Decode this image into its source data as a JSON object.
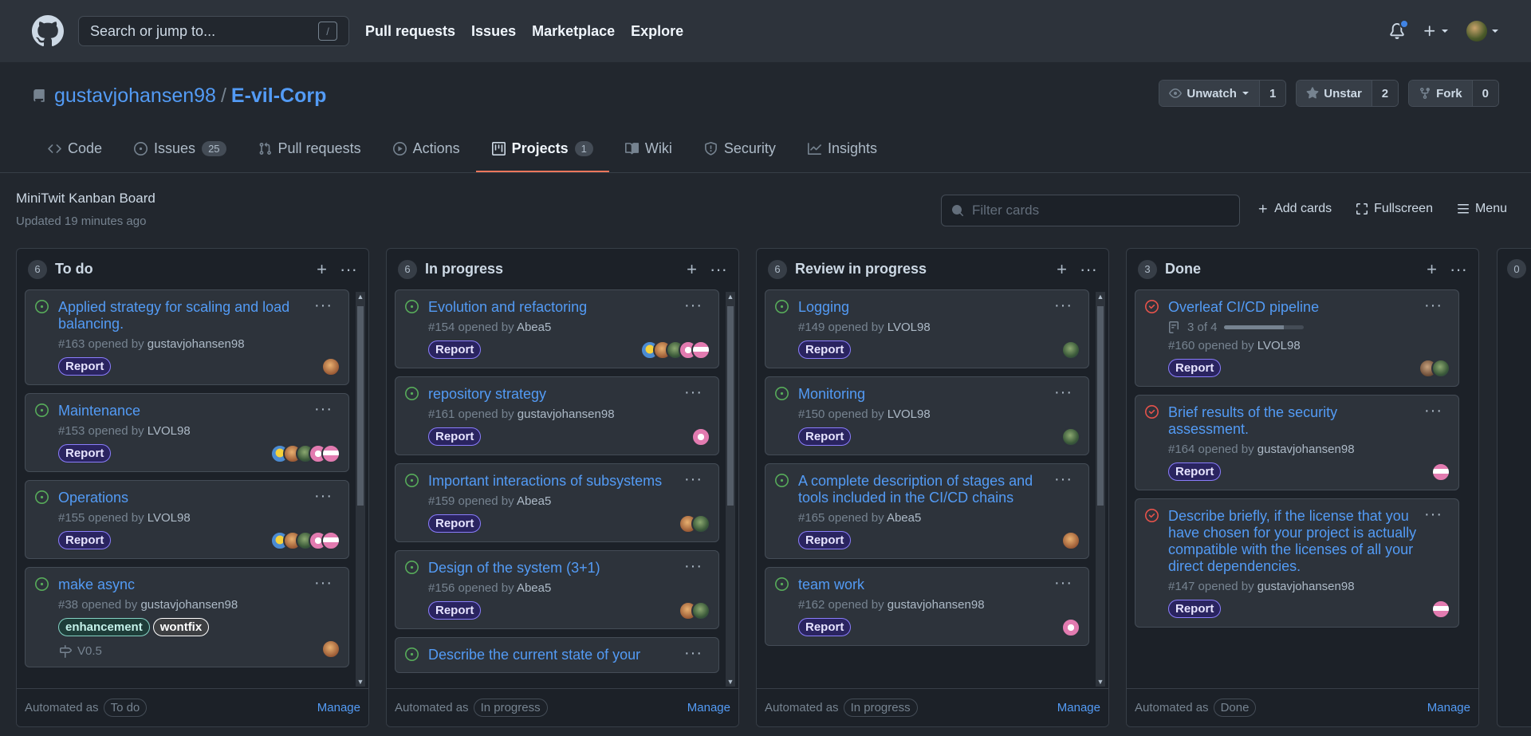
{
  "header": {
    "search_placeholder": "Search or jump to...",
    "search_key": "/",
    "nav": [
      "Pull requests",
      "Issues",
      "Marketplace",
      "Explore"
    ]
  },
  "repo": {
    "owner": "gustavjohansen98",
    "separator": "/",
    "name": "E-vil-Corp",
    "unwatch_label": "Unwatch",
    "unwatch_count": "1",
    "unstar_label": "Unstar",
    "unstar_count": "2",
    "fork_label": "Fork",
    "fork_count": "0"
  },
  "tabs": [
    {
      "label": "Code",
      "count": ""
    },
    {
      "label": "Issues",
      "count": "25"
    },
    {
      "label": "Pull requests",
      "count": ""
    },
    {
      "label": "Actions",
      "count": ""
    },
    {
      "label": "Projects",
      "count": "1"
    },
    {
      "label": "Wiki",
      "count": ""
    },
    {
      "label": "Security",
      "count": ""
    },
    {
      "label": "Insights",
      "count": ""
    }
  ],
  "project": {
    "name": "MiniTwit Kanban Board",
    "updated": "Updated 19 minutes ago",
    "filter_placeholder": "Filter cards",
    "add_cards": "Add cards",
    "fullscreen": "Fullscreen",
    "menu": "Menu"
  },
  "columns": [
    {
      "count": "6",
      "title": "To do",
      "automated_prefix": "Automated as",
      "automated": "To do",
      "manage": "Manage",
      "cards": [
        {
          "title": "Applied strategy for scaling and load balancing.",
          "number": "#163 opened by",
          "author": "gustavjohansen98",
          "labels": [
            "Report"
          ]
        },
        {
          "title": "Maintenance",
          "number": "#153 opened by",
          "author": "LVOL98",
          "labels": [
            "Report"
          ]
        },
        {
          "title": "Operations",
          "number": "#155 opened by",
          "author": "LVOL98",
          "labels": [
            "Report"
          ]
        },
        {
          "title": "make async",
          "number": "#38 opened by",
          "author": "gustavjohansen98",
          "labels": [
            "enhancement",
            "wontfix"
          ],
          "milestone": "V0.5"
        }
      ]
    },
    {
      "count": "6",
      "title": "In progress",
      "automated_prefix": "Automated as",
      "automated": "In progress",
      "manage": "Manage",
      "cards": [
        {
          "title": "Evolution and refactoring",
          "number": "#154 opened by",
          "author": "Abea5",
          "labels": [
            "Report"
          ]
        },
        {
          "title": "repository strategy",
          "number": "#161 opened by",
          "author": "gustavjohansen98",
          "labels": [
            "Report"
          ]
        },
        {
          "title": "Important interactions of subsystems",
          "number": "#159 opened by",
          "author": "Abea5",
          "labels": [
            "Report"
          ]
        },
        {
          "title": "Design of the system (3+1)",
          "number": "#156 opened by",
          "author": "Abea5",
          "labels": [
            "Report"
          ]
        },
        {
          "title": "Describe the current state of your",
          "number": "",
          "author": "",
          "labels": []
        }
      ]
    },
    {
      "count": "6",
      "title": "Review in progress",
      "automated_prefix": "Automated as",
      "automated": "In progress",
      "manage": "Manage",
      "cards": [
        {
          "title": "Logging",
          "number": "#149 opened by",
          "author": "LVOL98",
          "labels": [
            "Report"
          ]
        },
        {
          "title": "Monitoring",
          "number": "#150 opened by",
          "author": "LVOL98",
          "labels": [
            "Report"
          ]
        },
        {
          "title": "A complete description of stages and tools included in the CI/CD chains",
          "number": "#165 opened by",
          "author": "Abea5",
          "labels": [
            "Report"
          ]
        },
        {
          "title": "team work",
          "number": "#162 opened by",
          "author": "gustavjohansen98",
          "labels": [
            "Report"
          ]
        }
      ]
    },
    {
      "count": "3",
      "title": "Done",
      "automated_prefix": "Automated as",
      "automated": "Done",
      "manage": "Manage",
      "cards": [
        {
          "title": "Overleaf CI/CD pipeline",
          "progress": "3 of 4",
          "progress_fraction": 0.75,
          "number": "#160 opened by",
          "author": "LVOL98",
          "labels": [
            "Report"
          ]
        },
        {
          "title": "Brief results of the security assessment.",
          "number": "#164 opened by",
          "author": "gustavjohansen98",
          "labels": [
            "Report"
          ]
        },
        {
          "title": "Describe briefly, if the license that you have chosen for your project is actually compatible with the licenses of all your direct dependencies.",
          "number": "#147 opened by",
          "author": "gustavjohansen98",
          "labels": [
            "Report"
          ]
        }
      ]
    }
  ],
  "partial_column": {
    "count": "0"
  },
  "colors": {
    "accent": "#539bf5",
    "open": "#57ab5a",
    "closed": "#e5534b",
    "tab_underline": "#ec775c"
  }
}
